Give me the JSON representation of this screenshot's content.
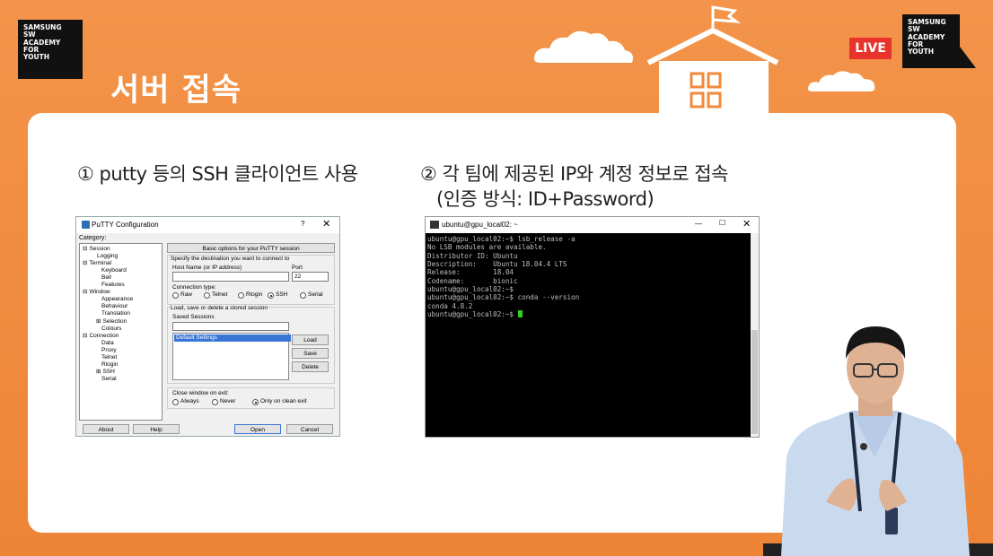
{
  "branding": {
    "logo_lines": [
      "SAMSUNG",
      "SW",
      "ACADEMY",
      "FOR",
      "YOUTH"
    ],
    "live_label": "LIVE"
  },
  "slide": {
    "title": "서버 접속",
    "caption_1": "① putty 등의 SSH 클라이언트 사용",
    "caption_2": "② 각 팀에 제공된 IP와 계정 정보로 접속",
    "caption_2_sub": "(인증 방식: ID+Password)"
  },
  "putty": {
    "window_title": "PuTTY Configuration",
    "help_glyph": "?",
    "close_glyph": "✕",
    "category_label": "Category:",
    "tree": [
      {
        "label": "Session",
        "depth": 0,
        "expander": "⊟"
      },
      {
        "label": "Logging",
        "depth": 2,
        "expander": ""
      },
      {
        "label": "Terminal",
        "depth": 0,
        "expander": "⊟"
      },
      {
        "label": "Keyboard",
        "depth": 1,
        "expander": ""
      },
      {
        "label": "Bell",
        "depth": 1,
        "expander": ""
      },
      {
        "label": "Features",
        "depth": 1,
        "expander": ""
      },
      {
        "label": "Window",
        "depth": 0,
        "expander": "⊟"
      },
      {
        "label": "Appearance",
        "depth": 1,
        "expander": ""
      },
      {
        "label": "Behaviour",
        "depth": 1,
        "expander": ""
      },
      {
        "label": "Translation",
        "depth": 1,
        "expander": ""
      },
      {
        "label": "Selection",
        "depth": 1,
        "expander": "⊞"
      },
      {
        "label": "Colours",
        "depth": 1,
        "expander": ""
      },
      {
        "label": "Connection",
        "depth": 0,
        "expander": "⊟"
      },
      {
        "label": "Data",
        "depth": 1,
        "expander": ""
      },
      {
        "label": "Proxy",
        "depth": 1,
        "expander": ""
      },
      {
        "label": "Telnet",
        "depth": 1,
        "expander": ""
      },
      {
        "label": "Rlogin",
        "depth": 1,
        "expander": ""
      },
      {
        "label": "SSH",
        "depth": 1,
        "expander": "⊞"
      },
      {
        "label": "Serial",
        "depth": 1,
        "expander": ""
      }
    ],
    "header_button": "Basic options for your PuTTY session",
    "dest_label": "Specify the destination you want to connect to",
    "host_label": "Host Name (or IP address)",
    "host_value": "",
    "port_label": "Port",
    "port_value": "22",
    "conn_type_label": "Connection type:",
    "conn_types": [
      "Raw",
      "Telnet",
      "Rlogin",
      "SSH",
      "Serial"
    ],
    "conn_selected": "SSH",
    "sessions_group_label": "Load, save or delete a stored session",
    "saved_sessions_label": "Saved Sessions",
    "saved_sessions_value": "",
    "sessions_list": [
      "Default Settings"
    ],
    "load_button": "Load",
    "save_button": "Save",
    "delete_button": "Delete",
    "close_on_exit_label": "Close window on exit:",
    "close_options": [
      "Always",
      "Never",
      "Only on clean exit"
    ],
    "close_selected": "Only on clean exit",
    "about_button": "About",
    "help_button": "Help",
    "open_button": "Open",
    "cancel_button": "Cancel"
  },
  "terminal": {
    "window_title": "ubuntu@gpu_local02: ~",
    "minimize_glyph": "—",
    "maximize_glyph": "☐",
    "close_glyph": "✕",
    "lines": [
      "ubuntu@gpu_local02:~$ lsb_release -a",
      "No LSB modules are available.",
      "Distributor ID: Ubuntu",
      "Description:    Ubuntu 18.04.4 LTS",
      "Release:        18.04",
      "Codename:       bionic",
      "ubuntu@gpu_local02:~$",
      "ubuntu@gpu_local02:~$ conda --version",
      "conda 4.8.2"
    ],
    "prompt": "ubuntu@gpu_local02:~$ "
  },
  "colors": {
    "background": "#f08a3c",
    "card": "#ffffff",
    "live_badge": "#e8332d",
    "cursor": "#34d027"
  }
}
